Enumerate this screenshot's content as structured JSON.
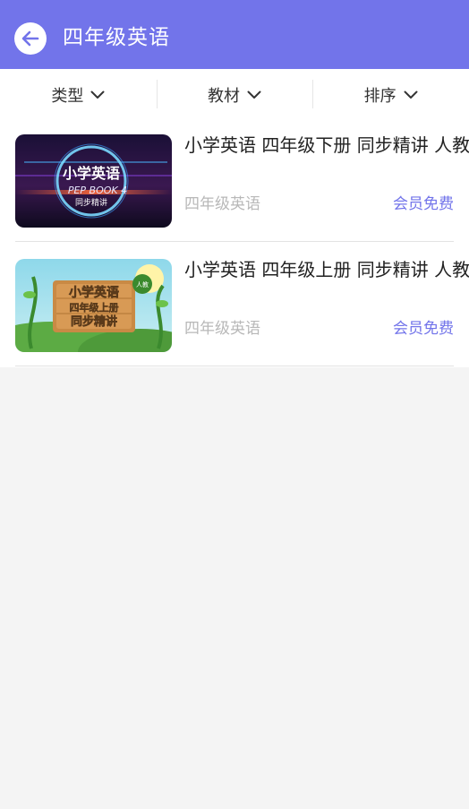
{
  "header": {
    "title": "四年级英语",
    "icon": "back-arrow-icon",
    "color": "#7274ea"
  },
  "filters": [
    {
      "label": "类型",
      "icon": "chevron-down-icon"
    },
    {
      "label": "教材",
      "icon": "chevron-down-icon"
    },
    {
      "label": "排序",
      "icon": "chevron-down-icon"
    }
  ],
  "courses": [
    {
      "title": "小学英语 四年级下册 同步精讲 人教",
      "subject": "四年级英语",
      "badge": "会员免费",
      "thumb": {
        "line1": "小学英语",
        "line2": "PEP BOOK 4",
        "line3": "同步精讲"
      }
    },
    {
      "title": "小学英语 四年级上册 同步精讲 人教",
      "subject": "四年级英语",
      "badge": "会员免费",
      "thumb": {
        "line1": "小学英语",
        "line2": "四年级上册",
        "line3": "同步精讲",
        "tag": "人教"
      }
    }
  ]
}
